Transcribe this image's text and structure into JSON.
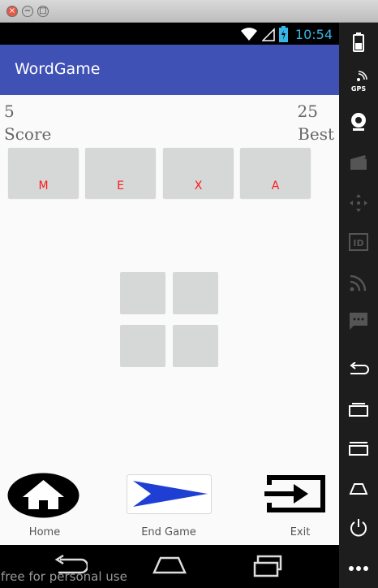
{
  "window": {
    "close_glyph": "×",
    "min_glyph": "−",
    "max_glyph": "□"
  },
  "status_bar": {
    "time": "10:54",
    "icons": [
      "wifi-icon",
      "signal-icon",
      "battery-charging-icon"
    ]
  },
  "app_bar": {
    "title": "WordGame",
    "color": "#3f51b5"
  },
  "score": {
    "value": "5",
    "label": "Score"
  },
  "best": {
    "value": "25",
    "label": "Best"
  },
  "letters": [
    "M",
    "E",
    "X",
    "A"
  ],
  "letter_color": "#ff1a1a",
  "answer_slots": 4,
  "actions": {
    "home": "Home",
    "end_game": "End Game",
    "exit": "Exit"
  },
  "sidebar_icons": [
    "battery-icon",
    "gps-icon",
    "camera-icon",
    "video-icon",
    "dpad-icon",
    "id-icon",
    "cast-icon",
    "message-icon",
    "back-icon",
    "recents-icon",
    "menu-icon",
    "home-icon",
    "power-icon",
    "more-icon"
  ],
  "sidebar_labels": {
    "gps": "GPS",
    "id": "ID"
  },
  "watermark": "free for personal use"
}
